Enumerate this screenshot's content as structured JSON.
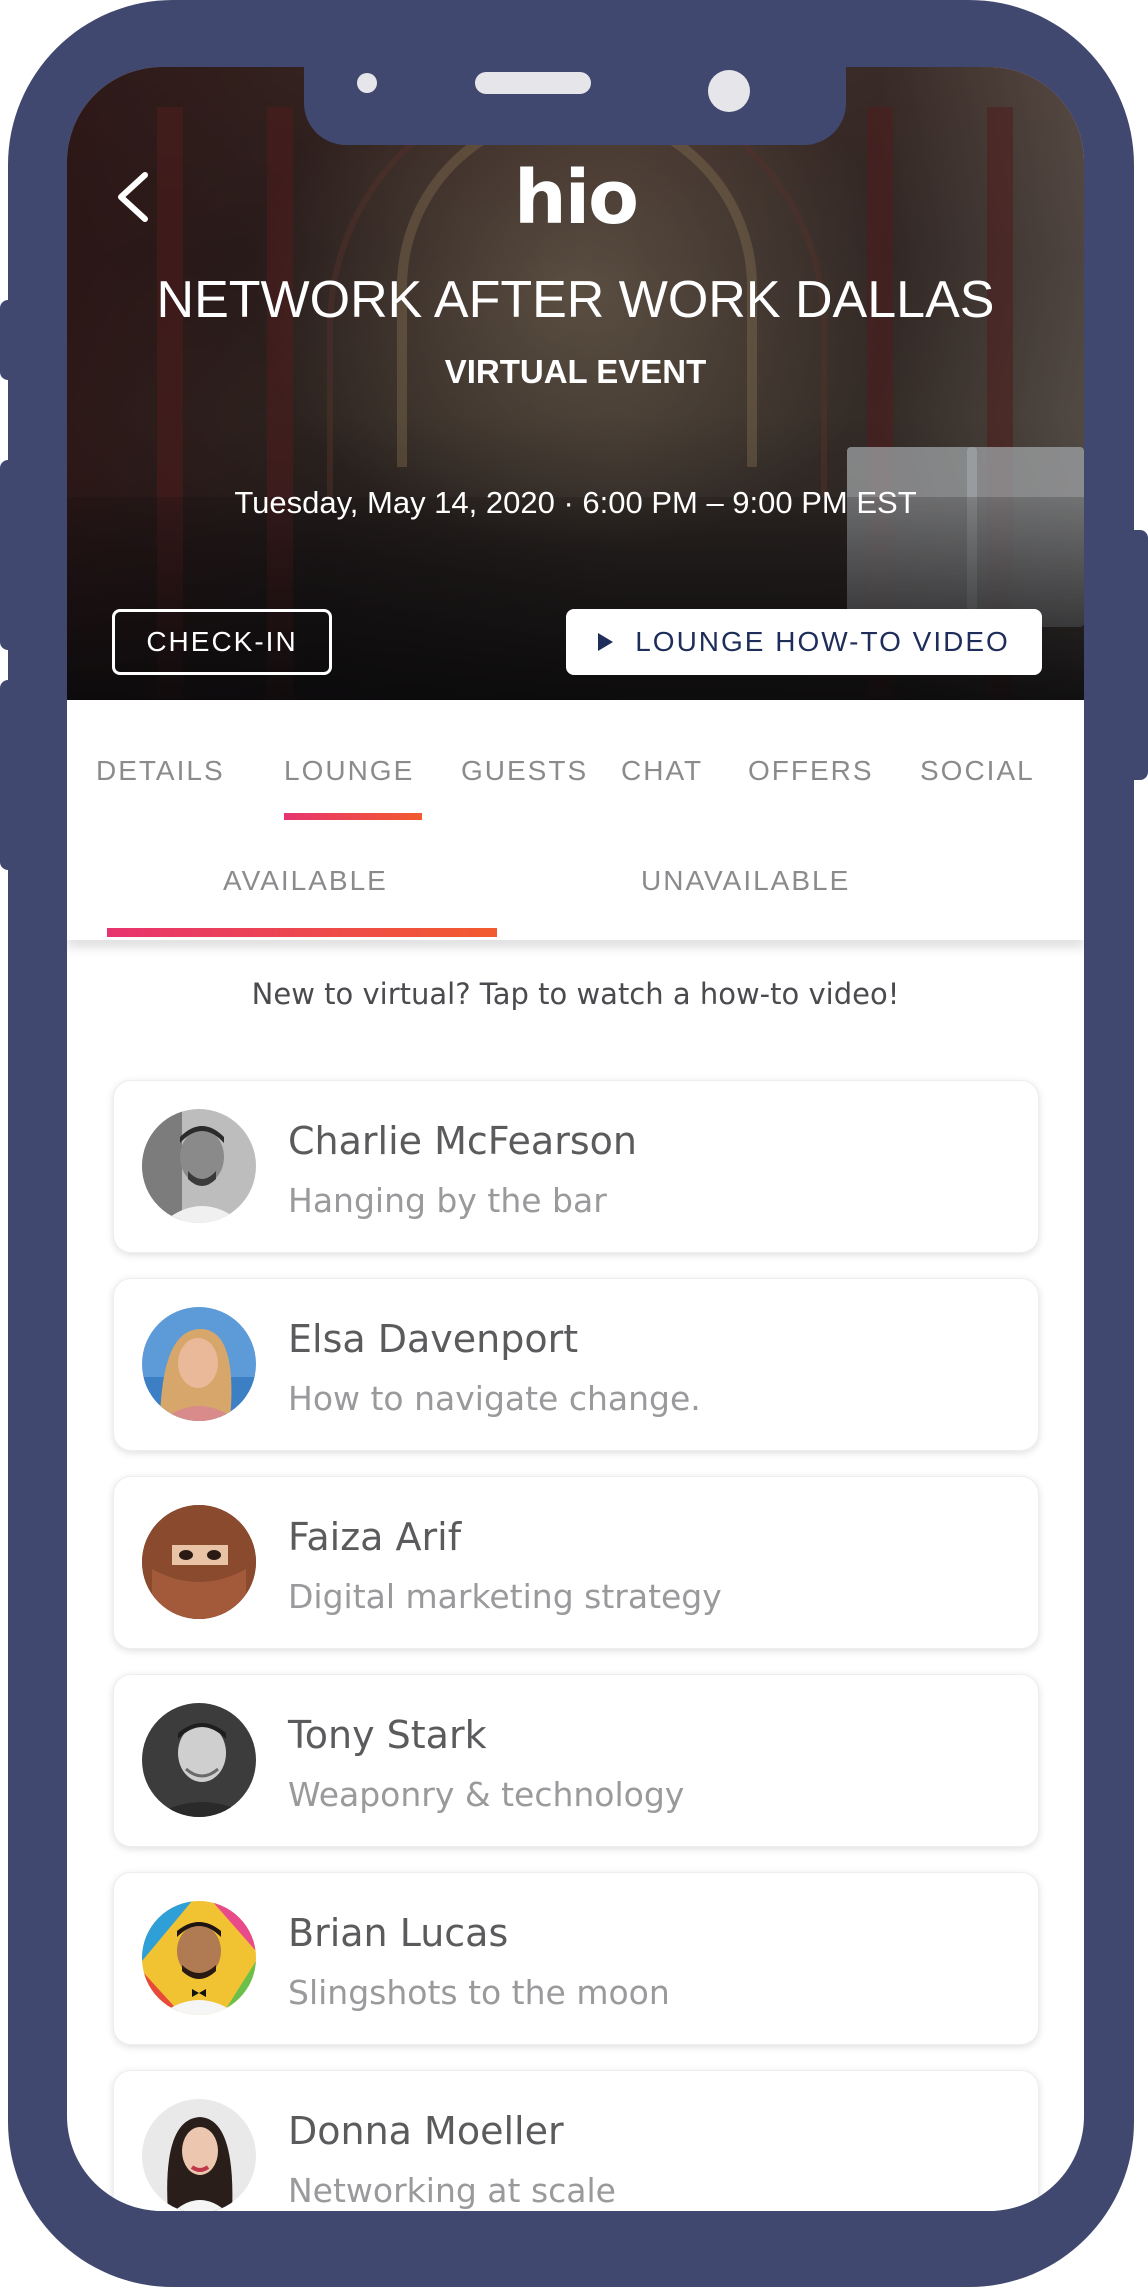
{
  "app": {
    "logo": "hio"
  },
  "event": {
    "title": "NETWORK AFTER WORK DALLAS",
    "subtitle": "VIRTUAL EVENT",
    "datetime": "Tuesday, May 14, 2020 · 6:00 PM – 9:00 PM EST",
    "checkin_label": "CHECK-IN",
    "howto_label": "LOUNGE HOW-TO VIDEO"
  },
  "tabs": [
    {
      "label": "DETAILS"
    },
    {
      "label": "LOUNGE",
      "active": true
    },
    {
      "label": "GUESTS"
    },
    {
      "label": "CHAT"
    },
    {
      "label": "OFFERS"
    },
    {
      "label": "SOCIAL"
    }
  ],
  "subtabs": [
    {
      "label": "AVAILABLE",
      "active": true
    },
    {
      "label": "UNAVAILABLE"
    }
  ],
  "promo_text": "New to virtual? Tap to watch a how-to video!",
  "attendees": [
    {
      "name": "Charlie McFearson",
      "status": "Hanging by the bar"
    },
    {
      "name": "Elsa Davenport",
      "status": "How to navigate change."
    },
    {
      "name": "Faiza Arif",
      "status": "Digital marketing strategy"
    },
    {
      "name": "Tony Stark",
      "status": "Weaponry & technology"
    },
    {
      "name": "Brian Lucas",
      "status": "Slingshots to the moon"
    },
    {
      "name": "Donna Moeller",
      "status": "Networking at scale"
    }
  ],
  "colors": {
    "phone_frame": "#41486f",
    "accent_start": "#e8346f",
    "accent_end": "#f25b2e",
    "button_text": "#1f2d5a"
  }
}
